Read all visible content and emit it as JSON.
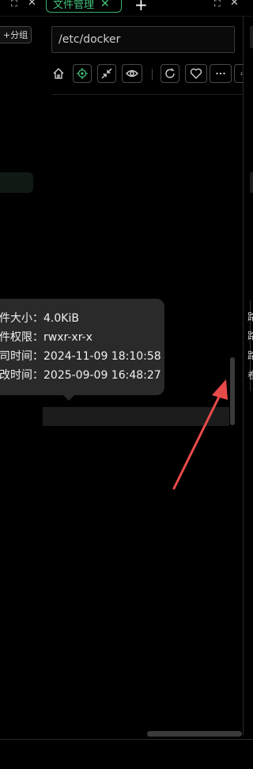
{
  "tab": {
    "label": "文件管理"
  },
  "group_button": {
    "label": "+分组"
  },
  "path": {
    "value": "/etc/docker"
  },
  "toolbar": {
    "buttons": [
      "home-icon",
      "locate-icon",
      "collapse-icon",
      "eye-icon",
      "refresh-icon",
      "heart-icon",
      "more-icon",
      "upload-icon"
    ]
  },
  "tooltip": {
    "rows": [
      {
        "label": "件大小：",
        "value": "4.0KiB"
      },
      {
        "label": "件权限：",
        "value": "rwxr-xr-x"
      },
      {
        "label": "司时间：",
        "value": "2024-11-09 18:10:58"
      },
      {
        "label": "改时间：",
        "value": "2025-09-09 16:48:27"
      }
    ]
  },
  "right_edge_fragments": [
    "路",
    "路",
    "路",
    "卷"
  ]
}
